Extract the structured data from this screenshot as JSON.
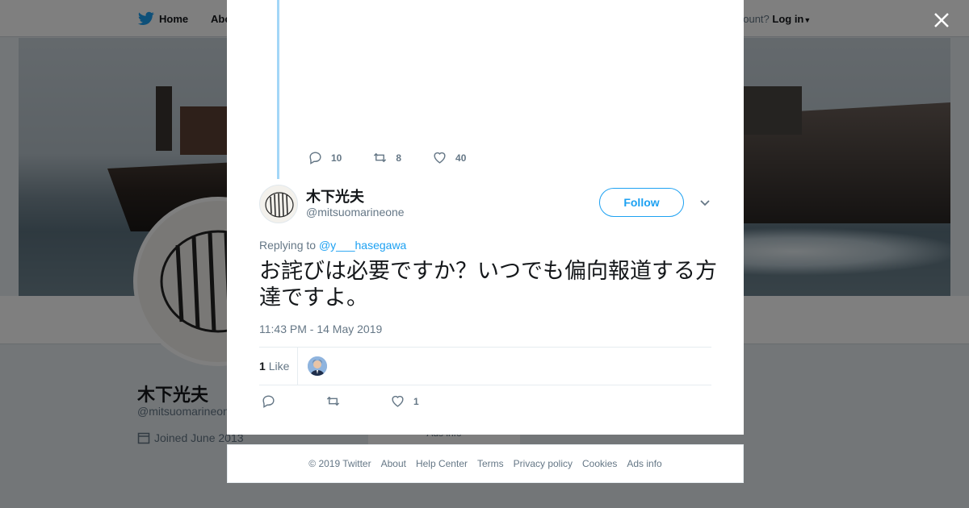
{
  "background_page": {
    "nav_home_label": "Home",
    "nav_about_label": "Abo",
    "account_prompt": "account?",
    "login_label": "Log in",
    "profile_name": "木下光夫",
    "profile_handle": "@mitsuomarineone",
    "joined": "Joined June 2013",
    "ad_label": "Ads info"
  },
  "previous_tweet": {
    "reply_count": "10",
    "retweet_count": "8",
    "like_count": "40"
  },
  "tweet": {
    "display_name": "木下光夫",
    "handle": "@mitsuomarineone",
    "follow_label": "Follow",
    "replying_prefix": "Replying to",
    "replying_mention": "@y___hasegawa",
    "text": "お詫びは必要ですか？いつでも偏向報道する方達ですよ。",
    "timestamp": "11:43 PM - 14 May 2019",
    "likes_number": "1",
    "likes_word": "Like",
    "action_like_count": "1"
  },
  "footer": {
    "copyright": "© 2019 Twitter",
    "links": [
      "About",
      "Help Center",
      "Terms",
      "Privacy policy",
      "Cookies",
      "Ads info"
    ]
  },
  "icons": {
    "close": "close-icon",
    "reply": "reply-icon",
    "retweet": "retweet-icon",
    "like": "heart-icon",
    "caret": "chevron-down-icon",
    "bird": "twitter-bird-icon"
  },
  "colors": {
    "twitter_blue": "#1da1f2",
    "thread_line": "#a3d6f7",
    "secondary_text": "#657786"
  }
}
